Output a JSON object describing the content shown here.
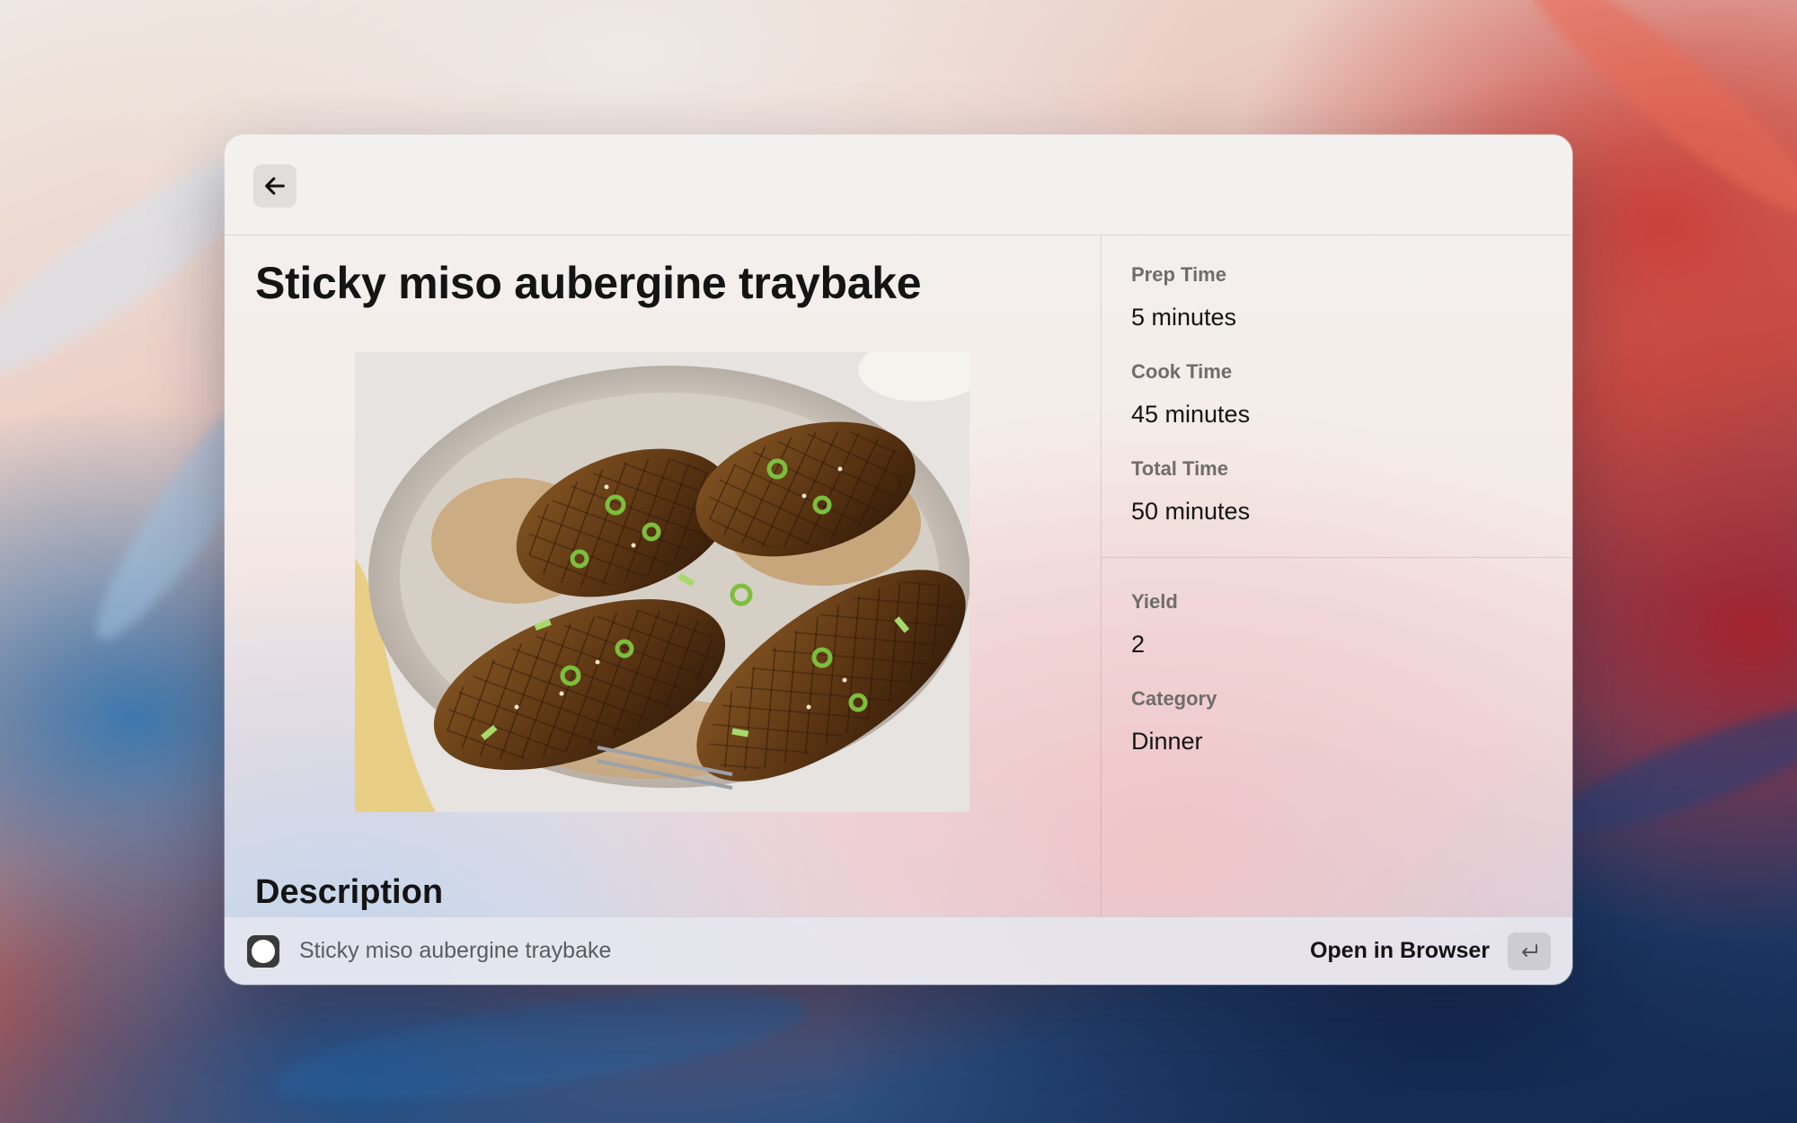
{
  "window": {
    "back_icon": "arrow-left-icon"
  },
  "recipe": {
    "title": "Sticky miso aubergine traybake",
    "image_alt": "Roasted miso aubergine halves on a platter with rice and spring onions",
    "description_heading": "Description"
  },
  "metadata": {
    "group_1": [
      {
        "label": "Prep Time",
        "value": "5 minutes"
      },
      {
        "label": "Cook Time",
        "value": "45 minutes"
      },
      {
        "label": "Total Time",
        "value": "50 minutes"
      }
    ],
    "group_2": [
      {
        "label": "Yield",
        "value": "2"
      },
      {
        "label": "Category",
        "value": "Dinner"
      }
    ]
  },
  "footer": {
    "app_icon": "app-icon",
    "title": "Sticky miso aubergine traybake",
    "action_label": "Open in Browser",
    "action_key_icon": "return-key-icon"
  }
}
